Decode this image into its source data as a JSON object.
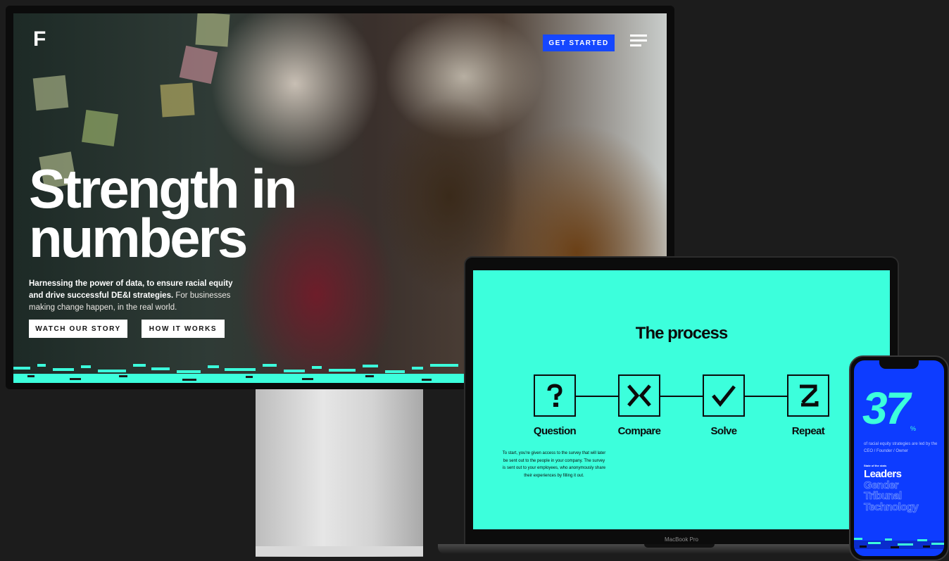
{
  "hero": {
    "logo_letter": "F",
    "cta_label": "GET STARTED",
    "headline_line1": "Strength in",
    "headline_line2": "numbers",
    "subtext_bold": "Harnessing the power of data, to ensure racial equity and drive successful DE&I strategies.",
    "subtext_regular": "For businesses making change happen, in the real world.",
    "button_watch": "WATCH OUR STORY",
    "button_how": "HOW IT WORKS"
  },
  "process": {
    "title": "The process",
    "steps": [
      {
        "label": "Question",
        "icon": "question-mark-icon"
      },
      {
        "label": "Compare",
        "icon": "compare-arrows-icon"
      },
      {
        "label": "Solve",
        "icon": "checkmark-icon"
      },
      {
        "label": "Repeat",
        "icon": "repeat-z-icon"
      }
    ],
    "description": "To start, you're given access to the survey that will later be sent out to the people in your company. The survey is sent out to your employees, who anonymously share their experiences by filling it out."
  },
  "laptop": {
    "label": "MacBook Pro"
  },
  "phone": {
    "stat_value": "37",
    "stat_unit": "%",
    "stat_description": "of racial equity strategies are led by the CEO / Founder / Owner",
    "kicker": "State of the stats",
    "categories": [
      "Leaders",
      "Gender",
      "Tribunal",
      "Technology"
    ]
  },
  "colors": {
    "accent_teal": "#3cffdc",
    "brand_blue": "#1547ff",
    "phone_blue": "#0d3cff",
    "background": "#1c1c1c"
  }
}
